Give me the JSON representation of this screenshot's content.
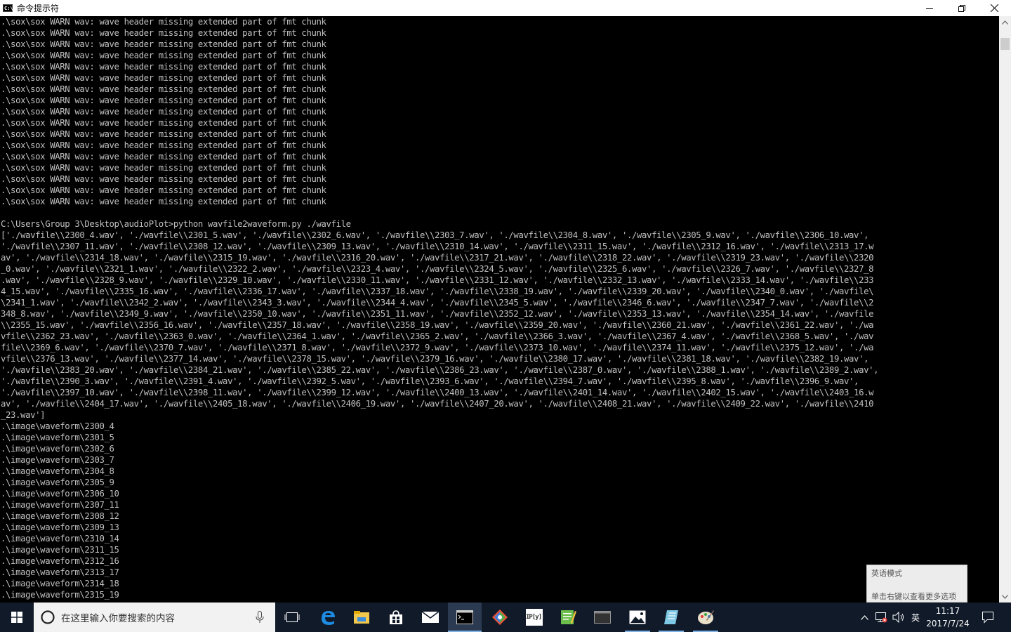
{
  "window": {
    "title": "命令提示符",
    "app_icon_text": "C:\\",
    "minimize_icon": "minimize-icon",
    "maximize_icon": "restore-icon",
    "close_icon": "close-icon"
  },
  "console": {
    "lines": [
      ".\\sox\\sox WARN wav: wave header missing extended part of fmt chunk",
      ".\\sox\\sox WARN wav: wave header missing extended part of fmt chunk",
      ".\\sox\\sox WARN wav: wave header missing extended part of fmt chunk",
      ".\\sox\\sox WARN wav: wave header missing extended part of fmt chunk",
      ".\\sox\\sox WARN wav: wave header missing extended part of fmt chunk",
      ".\\sox\\sox WARN wav: wave header missing extended part of fmt chunk",
      ".\\sox\\sox WARN wav: wave header missing extended part of fmt chunk",
      ".\\sox\\sox WARN wav: wave header missing extended part of fmt chunk",
      ".\\sox\\sox WARN wav: wave header missing extended part of fmt chunk",
      ".\\sox\\sox WARN wav: wave header missing extended part of fmt chunk",
      ".\\sox\\sox WARN wav: wave header missing extended part of fmt chunk",
      ".\\sox\\sox WARN wav: wave header missing extended part of fmt chunk",
      ".\\sox\\sox WARN wav: wave header missing extended part of fmt chunk",
      ".\\sox\\sox WARN wav: wave header missing extended part of fmt chunk",
      ".\\sox\\sox WARN wav: wave header missing extended part of fmt chunk",
      ".\\sox\\sox WARN wav: wave header missing extended part of fmt chunk",
      ".\\sox\\sox WARN wav: wave header missing extended part of fmt chunk",
      "",
      "C:\\Users\\Group 3\\Desktop\\audioPlot>python wavfile2waveform.py ./wavfile",
      "['./wavfile\\\\2300_4.wav', './wavfile\\\\2301_5.wav', './wavfile\\\\2302_6.wav', './wavfile\\\\2303_7.wav', './wavfile\\\\2304_8.wav', './wavfile\\\\2305_9.wav', './wavfile\\\\2306_10.wav',",
      "'./wavfile\\\\2307_11.wav', './wavfile\\\\2308_12.wav', './wavfile\\\\2309_13.wav', './wavfile\\\\2310_14.wav', './wavfile\\\\2311_15.wav', './wavfile\\\\2312_16.wav', './wavfile\\\\2313_17.w",
      "av', './wavfile\\\\2314_18.wav', './wavfile\\\\2315_19.wav', './wavfile\\\\2316_20.wav', './wavfile\\\\2317_21.wav', './wavfile\\\\2318_22.wav', './wavfile\\\\2319_23.wav', './wavfile\\\\2320",
      "_0.wav', './wavfile\\\\2321_1.wav', './wavfile\\\\2322_2.wav', './wavfile\\\\2323_4.wav', './wavfile\\\\2324_5.wav', './wavfile\\\\2325_6.wav', './wavfile\\\\2326_7.wav', './wavfile\\\\2327_8",
      ".wav', './wavfile\\\\2328_9.wav', './wavfile\\\\2329_10.wav', './wavfile\\\\2330_11.wav', './wavfile\\\\2331_12.wav', './wavfile\\\\2332_13.wav', './wavfile\\\\2333_14.wav', './wavfile\\\\233",
      "4_15.wav', './wavfile\\\\2335_16.wav', './wavfile\\\\2336_17.wav', './wavfile\\\\2337_18.wav', './wavfile\\\\2338_19.wav', './wavfile\\\\2339_20.wav', './wavfile\\\\2340_0.wav', './wavfile\\",
      "\\2341_1.wav', './wavfile\\\\2342_2.wav', './wavfile\\\\2343_3.wav', './wavfile\\\\2344_4.wav', './wavfile\\\\2345_5.wav', './wavfile\\\\2346_6.wav', './wavfile\\\\2347_7.wav', './wavfile\\\\2",
      "348_8.wav', './wavfile\\\\2349_9.wav', './wavfile\\\\2350_10.wav', './wavfile\\\\2351_11.wav', './wavfile\\\\2352_12.wav', './wavfile\\\\2353_13.wav', './wavfile\\\\2354_14.wav', './wavfile",
      "\\\\2355_15.wav', './wavfile\\\\2356_16.wav', './wavfile\\\\2357_18.wav', './wavfile\\\\2358_19.wav', './wavfile\\\\2359_20.wav', './wavfile\\\\2360_21.wav', './wavfile\\\\2361_22.wav', './wa",
      "vfile\\\\2362_23.wav', './wavfile\\\\2363_0.wav', './wavfile\\\\2364_1.wav', './wavfile\\\\2365_2.wav', './wavfile\\\\2366_3.wav', './wavfile\\\\2367_4.wav', './wavfile\\\\2368_5.wav', './wav",
      "file\\\\2369_6.wav', './wavfile\\\\2370_7.wav', './wavfile\\\\2371_8.wav', './wavfile\\\\2372_9.wav', './wavfile\\\\2373_10.wav', './wavfile\\\\2374_11.wav', './wavfile\\\\2375_12.wav', './wa",
      "vfile\\\\2376_13.wav', './wavfile\\\\2377_14.wav', './wavfile\\\\2378_15.wav', './wavfile\\\\2379_16.wav', './wavfile\\\\2380_17.wav', './wavfile\\\\2381_18.wav', './wavfile\\\\2382_19.wav',",
      "'./wavfile\\\\2383_20.wav', './wavfile\\\\2384_21.wav', './wavfile\\\\2385_22.wav', './wavfile\\\\2386_23.wav', './wavfile\\\\2387_0.wav', './wavfile\\\\2388_1.wav', './wavfile\\\\2389_2.wav',",
      "'./wavfile\\\\2390_3.wav', './wavfile\\\\2391_4.wav', './wavfile\\\\2392_5.wav', './wavfile\\\\2393_6.wav', './wavfile\\\\2394_7.wav', './wavfile\\\\2395_8.wav', './wavfile\\\\2396_9.wav',",
      "'./wavfile\\\\2397_10.wav', './wavfile\\\\2398_11.wav', './wavfile\\\\2399_12.wav', './wavfile\\\\2400_13.wav', './wavfile\\\\2401_14.wav', './wavfile\\\\2402_15.wav', './wavfile\\\\2403_16.w",
      "av', './wavfile\\\\2404_17.wav', './wavfile\\\\2405_18.wav', './wavfile\\\\2406_19.wav', './wavfile\\\\2407_20.wav', './wavfile\\\\2408_21.wav', './wavfile\\\\2409_22.wav', './wavfile\\\\2410",
      "_23.wav']",
      ".\\image\\waveform\\2300_4",
      ".\\image\\waveform\\2301_5",
      ".\\image\\waveform\\2302_6",
      ".\\image\\waveform\\2303_7",
      ".\\image\\waveform\\2304_8",
      ".\\image\\waveform\\2305_9",
      ".\\image\\waveform\\2306_10",
      ".\\image\\waveform\\2307_11",
      ".\\image\\waveform\\2308_12",
      ".\\image\\waveform\\2309_13",
      ".\\image\\waveform\\2310_14",
      ".\\image\\waveform\\2311_15",
      ".\\image\\waveform\\2312_16",
      ".\\image\\waveform\\2313_17",
      ".\\image\\waveform\\2314_18",
      ".\\image\\waveform\\2315_19"
    ]
  },
  "ime_popup": {
    "title": "英语模式",
    "hint": "单击右键以查看更多选项"
  },
  "taskbar": {
    "search_placeholder": "在这里输入你要搜索的内容",
    "icons": [
      {
        "name": "task-view-icon"
      },
      {
        "name": "edge-icon"
      },
      {
        "name": "file-explorer-icon"
      },
      {
        "name": "store-icon"
      },
      {
        "name": "mail-icon"
      },
      {
        "name": "command-prompt-icon",
        "active": true
      },
      {
        "name": "git-icon"
      },
      {
        "name": "ipython-icon",
        "label": "IP[y]:"
      },
      {
        "name": "editor-icon"
      },
      {
        "name": "terminal-icon"
      },
      {
        "name": "photos-icon",
        "running": true
      },
      {
        "name": "notepad-icon",
        "running": true
      },
      {
        "name": "paint-icon",
        "running": true
      }
    ],
    "tray": {
      "ime_mode": "英",
      "time": "11:17",
      "date": "2017/7/24"
    }
  },
  "colors": {
    "console_bg": "#000000",
    "console_text": "#c0c0c0",
    "taskbar_bg": "#101a29",
    "active_indicator": "#7fb3e8"
  }
}
